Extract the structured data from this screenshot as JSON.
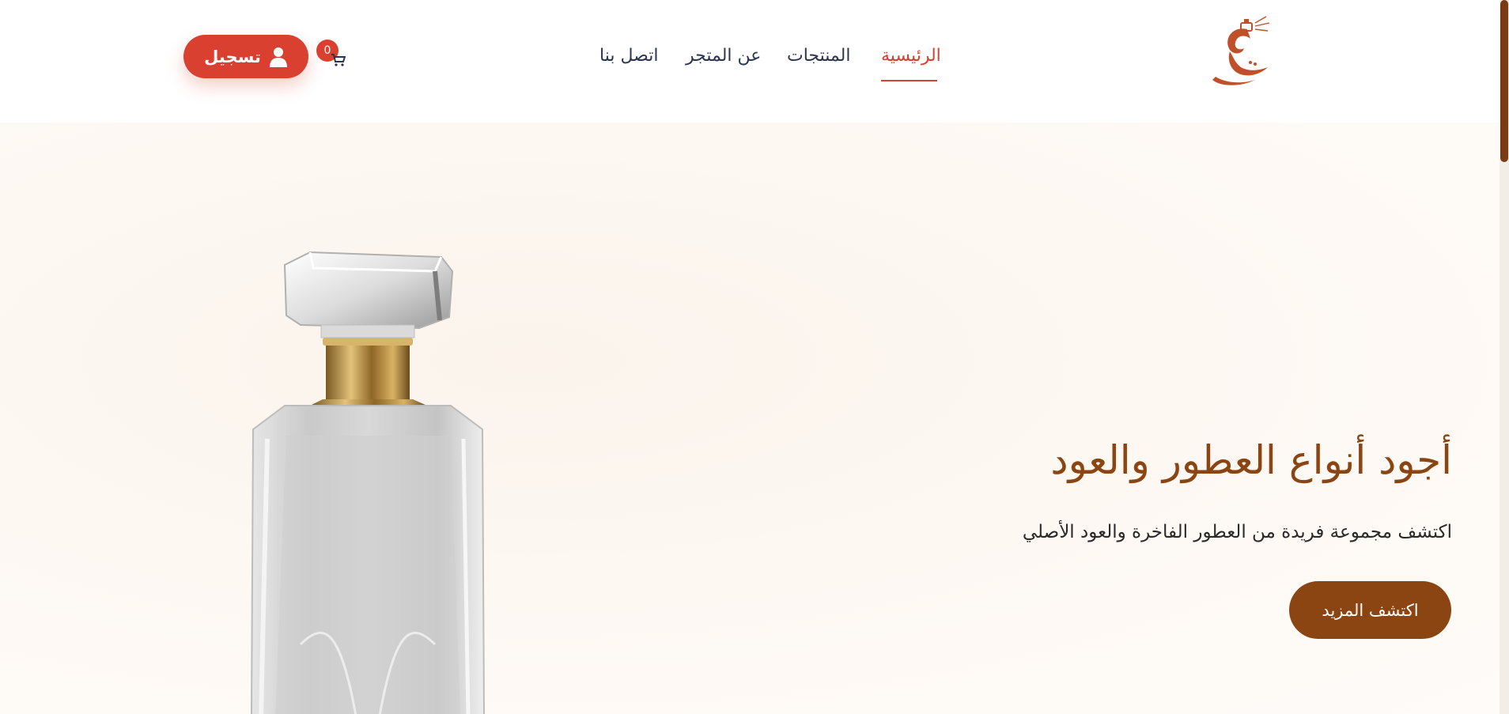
{
  "header": {
    "login_label": "تسجيل",
    "cart_count": "0",
    "nav": [
      {
        "label": "الرئيسية",
        "active": true
      },
      {
        "label": "المنتجات",
        "active": false
      },
      {
        "label": "عن المتجر",
        "active": false
      },
      {
        "label": "اتصل بنا",
        "active": false
      }
    ]
  },
  "hero": {
    "title": "أجود أنواع العطور والعود",
    "subtitle": "اكتشف مجموعة فريدة من العطور الفاخرة والعود الأصلي",
    "cta_label": "اكتشف المزيد"
  },
  "colors": {
    "accent": "#d9402f",
    "brand_brown": "#8b4513",
    "nav_text": "#2d3450"
  },
  "icons": [
    "user-icon",
    "cart-icon",
    "logo-icon"
  ]
}
